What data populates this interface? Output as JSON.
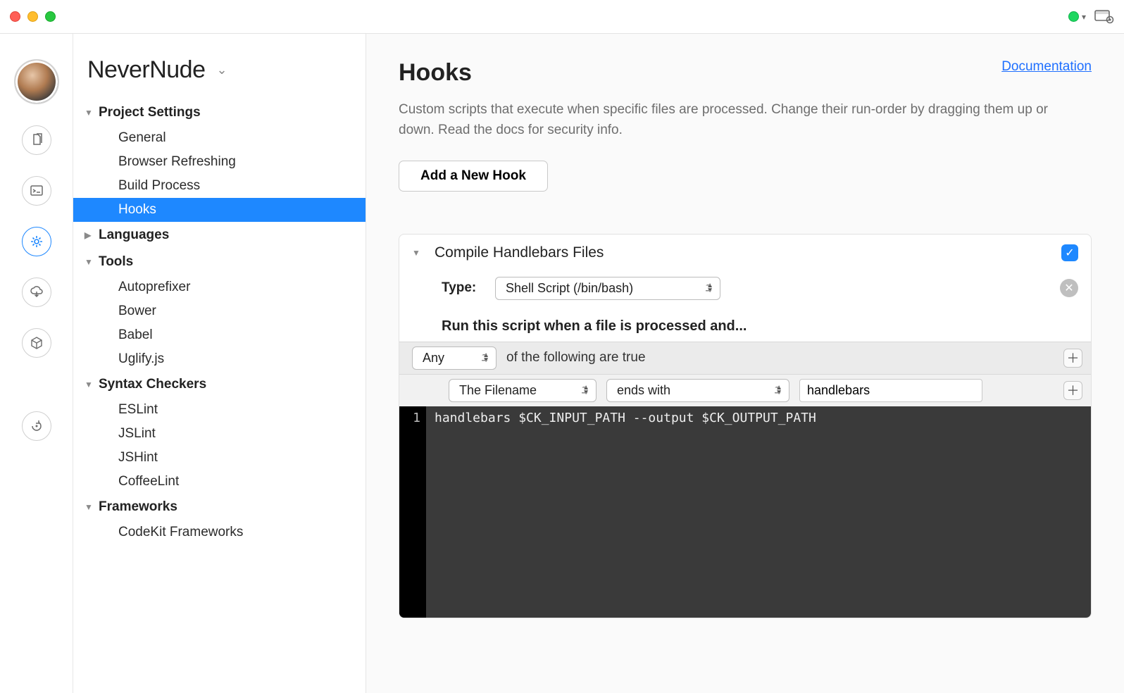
{
  "project": {
    "name": "NeverNude"
  },
  "sidebar": {
    "groups": [
      {
        "label": "Project Settings",
        "expanded": true,
        "items": [
          "General",
          "Browser Refreshing",
          "Build Process",
          "Hooks"
        ]
      },
      {
        "label": "Languages",
        "expanded": false,
        "items": []
      },
      {
        "label": "Tools",
        "expanded": true,
        "items": [
          "Autoprefixer",
          "Bower",
          "Babel",
          "Uglify.js"
        ]
      },
      {
        "label": "Syntax Checkers",
        "expanded": true,
        "items": [
          "ESLint",
          "JSLint",
          "JSHint",
          "CoffeeLint"
        ]
      },
      {
        "label": "Frameworks",
        "expanded": true,
        "items": [
          "CodeKit Frameworks"
        ]
      }
    ],
    "active": "Hooks"
  },
  "page": {
    "title": "Hooks",
    "docLink": "Documentation",
    "description": "Custom scripts that execute when specific files are processed. Change their run-order by dragging them up or down. Read the docs for security info.",
    "addButton": "Add a New Hook"
  },
  "hook": {
    "title": "Compile Handlebars Files",
    "enabled": true,
    "typeLabel": "Type:",
    "typeValue": "Shell Script (/bin/bash)",
    "runLabel": "Run this script when a file is processed and...",
    "matchMode": "Any",
    "matchSuffix": "of the following are true",
    "condition": {
      "field": "The Filename",
      "op": "ends with",
      "value": "handlebars"
    },
    "code": {
      "lineNo": "1",
      "text": "handlebars $CK_INPUT_PATH --output $CK_OUTPUT_PATH"
    }
  }
}
